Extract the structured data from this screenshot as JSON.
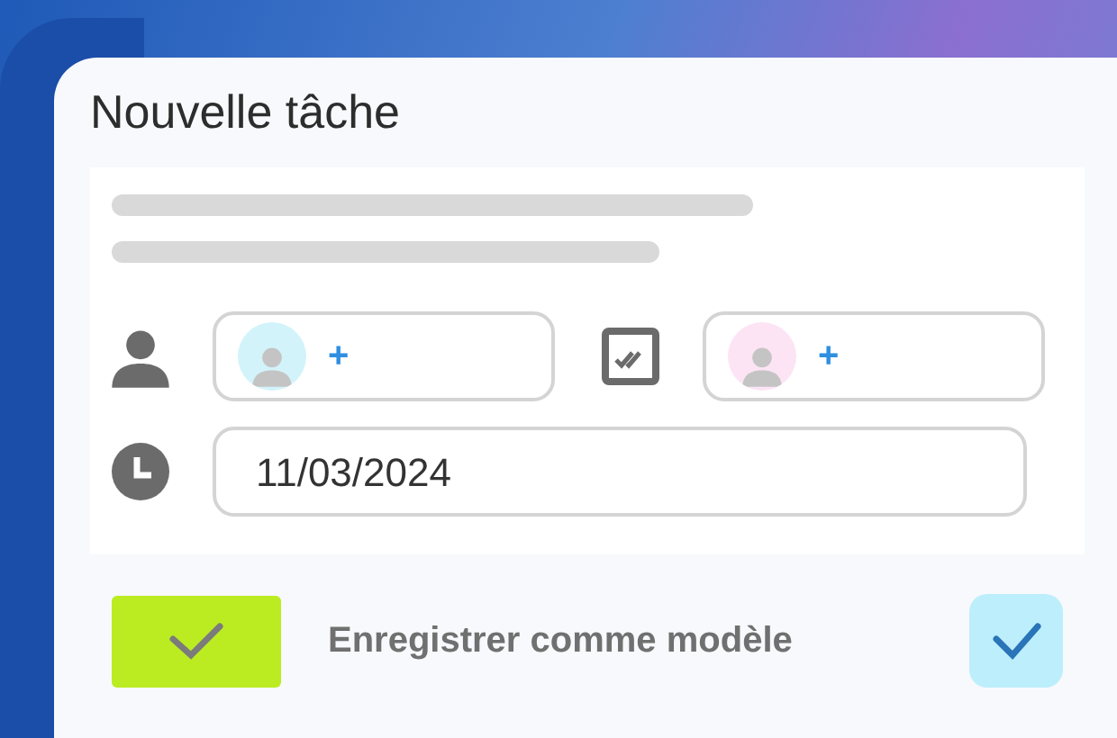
{
  "dialog": {
    "title": "Nouvelle tâche"
  },
  "people_pickers": [
    {
      "kind": "person",
      "color": "#d3f3fb",
      "add_label": "+"
    },
    {
      "kind": "checker",
      "color": "#fce4f4",
      "add_label": "+"
    }
  ],
  "date_field": {
    "value": "11/03/2024"
  },
  "save_template": {
    "label": "Enregistrer comme modèle",
    "checked": true
  }
}
